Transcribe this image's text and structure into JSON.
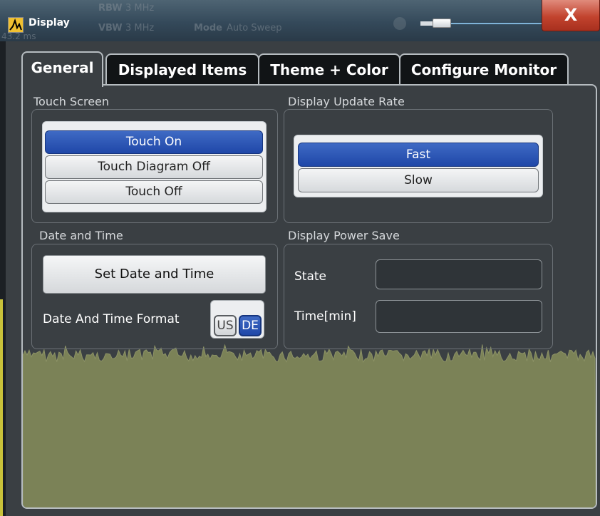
{
  "window": {
    "title": "Display",
    "background_text": {
      "rbw_label": "RBW",
      "rbw_value": "3 MHz",
      "vbw_label": "VBW",
      "vbw_value": "3 MHz",
      "mode_label": "Mode",
      "mode_value": "Auto Sweep",
      "left_fragment": "43.2 ms"
    },
    "close_symbol": "X"
  },
  "tabs": [
    {
      "label": "General",
      "active": true
    },
    {
      "label": "Displayed Items",
      "active": false
    },
    {
      "label": "Theme + Color",
      "active": false
    },
    {
      "label": "Configure Monitor",
      "active": false
    }
  ],
  "touch_screen": {
    "title": "Touch Screen",
    "options": [
      {
        "label": "Touch On",
        "selected": true
      },
      {
        "label": "Touch Diagram Off",
        "selected": false
      },
      {
        "label": "Touch Off",
        "selected": false
      }
    ]
  },
  "display_update_rate": {
    "title": "Display Update Rate",
    "options": [
      {
        "label": "Fast",
        "selected": true
      },
      {
        "label": "Slow",
        "selected": false
      }
    ]
  },
  "date_and_time": {
    "title": "Date and Time",
    "set_button": "Set Date and Time",
    "format_label": "Date And Time Format",
    "format_options": [
      "US",
      "DE"
    ],
    "format_selected": "DE"
  },
  "display_power_save": {
    "title": "Display Power Save",
    "state_label": "State",
    "state_value": "",
    "time_label": "Time[min]",
    "time_value": ""
  },
  "colors": {
    "accent_blue": "#2a52b0",
    "close_red": "#c2432e",
    "trace_green": "#7b8257"
  }
}
